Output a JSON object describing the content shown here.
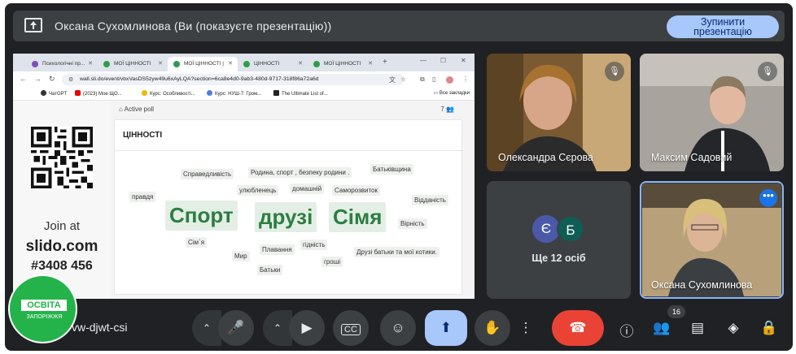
{
  "topbar": {
    "title": "Оксана Сухомлинова (Ви (показуєте презентацію))",
    "stop_line1": "Зупинити",
    "stop_line2": "презентацію"
  },
  "browser": {
    "tabs": [
      {
        "label": "Психологічні пр..."
      },
      {
        "label": "МОЇ ЦІННОСТІ"
      },
      {
        "label": "МОЇ ЦІННОСТІ |"
      },
      {
        "label": "ЦІННОСТІ"
      },
      {
        "label": "МОЇ ЦІННОСТІ"
      }
    ],
    "url": "wall.sli.do/event/vbxVasDS5zyw49u6xAyLQA?section=6ca8e4d0-9ab3-480d-9717-318f86a72a6d",
    "bookmarks": [
      "ЧатGPT",
      "(2023) Мое ЩО...",
      "Курс: Особливості...",
      "Курс: НУШ-7: Гром...",
      "The Ultimate List of..."
    ],
    "bookmarks_folder": "Все закладки"
  },
  "slido": {
    "join_text": "Join at",
    "site": "slido.com",
    "code": "#3408 456",
    "active_poll": "Active poll",
    "poll_count": "7",
    "poll_title": "ЦІННОСТІ",
    "words": [
      "Справедливість",
      "Родина, спорт , безпеку родини .",
      "Батьківщина",
      "правдя",
      "улюбленець",
      "домашній",
      "Саморозвиток",
      "Відданість",
      "Спорт",
      "друзі",
      "Сімя",
      "Вірність",
      "Сім`я",
      "гідність",
      "Мир",
      "Плавання",
      "Друзі батьки та мої котики.",
      "гроші",
      "Батьки"
    ]
  },
  "participants": {
    "p1": "Олександра Сєрова",
    "p2": "Максим Садовий",
    "avatar1": "Є",
    "avatar2": "Б",
    "others": "Ще 12 осіб",
    "self": "Оксана Сухомлинова"
  },
  "logo": {
    "line1": "ОСВІТА",
    "line2": "ЗАПОРІЖЖЯ"
  },
  "controls": {
    "meeting_code": "vw-djwt-csi",
    "people_count": "16"
  },
  "colors": {
    "bg": "#202124",
    "tile": "#3c4043",
    "present_accent": "#a8c7fa",
    "hangup": "#ea4335",
    "slido_green": "#2e7d43"
  }
}
